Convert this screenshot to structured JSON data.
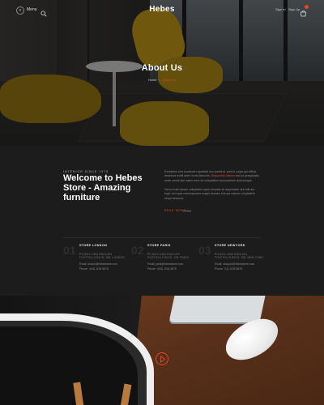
{
  "header": {
    "brand": "Hebes",
    "menu_label": "Menu",
    "logo_glyph": "≡",
    "sign_in": "Sign In",
    "divider": "/",
    "register": "Sign Up",
    "accent_color": "#e2492b"
  },
  "hero": {
    "title": "About Us",
    "breadcrumb": {
      "home": "Home",
      "current": "About Us"
    }
  },
  "about": {
    "kicker": "Interior Since 1970",
    "headline": "Welcome to Hebes Store - Amazing furniture",
    "paragraph1_a": "Excepteur sint occaecat cupidatat non proident, sunt in culpa qui officia deserunt mollit anim id est laborum. ",
    "paragraph1_highlight": "Sequential Interior",
    "paragraph1_b": " sed ut perspiciatis unde omnis iste natus error sit voluptatem accusantium doloremque.",
    "paragraph2": "Nemo enim ipsam voluptatem quia voluptas sit aspernatur aut odit aut fugit, sed quia consequuntur magni dolores eos qui ratione voluptatem sequi nesciunt.",
    "read_more": "READ MORE",
    "stores": [
      {
        "num": "01",
        "name": "STORE LONDON",
        "address": "PO BOX 2454 ENGLISH FOOTHILLS BLVD, SW, LONDON",
        "email": "Email: london@hebesstore.com",
        "phone": "Phone: +(44) 1234 5678"
      },
      {
        "num": "02",
        "name": "STORE PARIS",
        "address": "PO BOX 2454 ENGLISH FOOTHILLS BLVD, SW, PARIS",
        "email": "Email: paris@hebesstore.com",
        "phone": "Phone: +(33) 1234 5678"
      },
      {
        "num": "03",
        "name": "STORE NEWYORK",
        "address": "PO BOX 2454 ENGLISH FOOTHILLS BLVD, SW, NEW YORK",
        "email": "Email: newyork@hebesstore.com",
        "phone": "Phone: +(1) 1234 5678"
      }
    ]
  },
  "media": {
    "play_label": "Play video"
  }
}
